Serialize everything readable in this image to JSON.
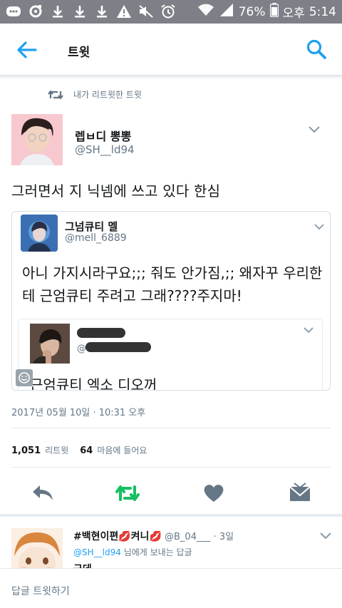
{
  "status_bar": {
    "battery": "76%",
    "ampm": "오후",
    "time": "5:14"
  },
  "app_bar": {
    "title": "트윗"
  },
  "retweet_context": {
    "label": "내가 리트윗한 트윗"
  },
  "tweet": {
    "author_name": "렙ㅂ디 뽕뽕",
    "author_handle": "@SH__ld94",
    "text": "그러면서 지 닉넴에 쓰고 있다 한심",
    "quoted": {
      "author_name": "그넘큐티 멜",
      "author_handle": "@mell_6889",
      "text": "아니 가지시라구요;;; 줘도 안가짐,;; 왜자꾸 우리한테 근엄큐티 주려고 그래????주지마!",
      "inner": {
        "handle_prefix": "@",
        "text": "근엄큐티 엑소 디오꺼"
      }
    },
    "timestamp": "2017년 05월 10일 · 10:31 오후",
    "retweet_count": "1,051",
    "retweet_label": "리트윗",
    "like_count": "64",
    "like_label": "마음에 들어요"
  },
  "reply": {
    "name": "#백현이편💋켜니💋",
    "handle": "@B_04___",
    "time": "· 3일",
    "to_mention": "@SH__ld94",
    "to_suffix": " 님에게 보내는 답글",
    "text_partial": "근데"
  },
  "composer": {
    "placeholder": "답글 트윗하기"
  },
  "colors": {
    "accent": "#1da1f2",
    "retweet_green": "#17bf63",
    "icon_gray": "#657786",
    "status_bar": "#7d8087"
  },
  "icons": {
    "back": "arrow-left-icon",
    "search": "search-icon",
    "retweet": "retweet-icon",
    "reply": "reply-icon",
    "like": "heart-icon",
    "dm": "envelope-icon"
  }
}
